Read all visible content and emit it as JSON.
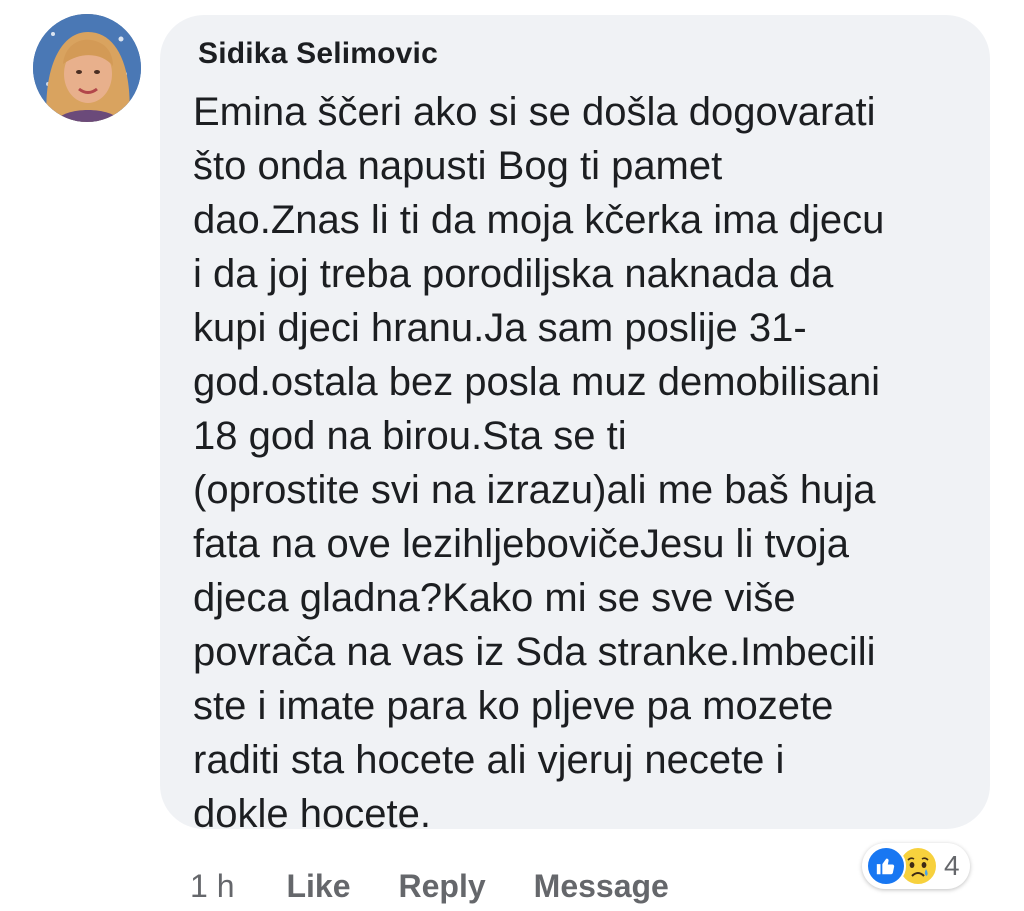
{
  "comment": {
    "author": "Sidika Selimovic",
    "lines": [
      "Emina ščeri ako si se došla dogovarati",
      "što onda napusti Bog ti pamet",
      "dao.Znas li ti da moja kčerka ima djecu",
      "i da joj treba porodiljska naknada da",
      "kupi djeci hranu.Ja sam poslije 31-",
      "god.ostala bez posla muz demobilisani",
      "18 god na birou.Sta se ti",
      "(oprostite svi na izrazu)ali me baš huja",
      "fata na ove lezihljebovičeJesu li tvoja",
      "djeca gladna?Kako mi se sve više",
      "povrača na vas iz Sda stranke.Imbecili",
      "ste i imate para ko pljeve pa mozete",
      "raditi sta hocete ali vjeruj necete i",
      "dokle hocete."
    ]
  },
  "actions": {
    "time": "1 h",
    "like": "Like",
    "reply": "Reply",
    "message": "Message"
  },
  "reactions": {
    "icons": [
      "like-icon",
      "sad-icon"
    ],
    "count": "4"
  },
  "colors": {
    "bubble": "#f0f2f5",
    "text": "#1c1e21",
    "secondary_text": "#65676b",
    "like_blue": "#1877f2",
    "sad_yellow": "#f7d13d"
  }
}
